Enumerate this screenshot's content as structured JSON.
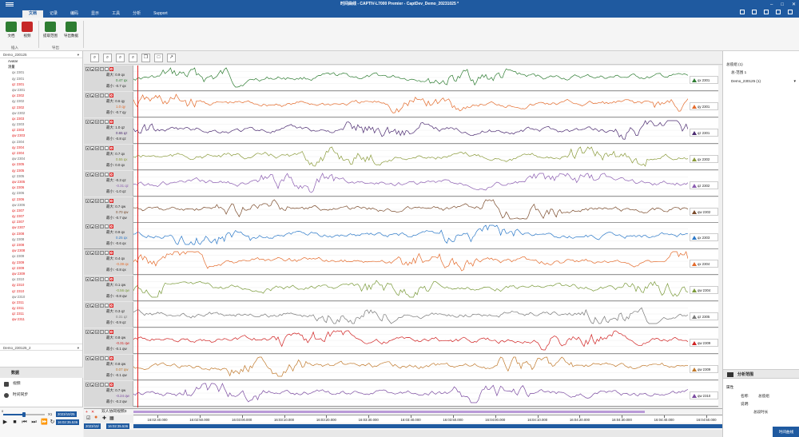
{
  "titlebar": {
    "title": "时间曲线 - CAPTIV-L7000 Premier - CaptDev_Demo_20231025 *"
  },
  "menu": {
    "tabs": [
      "文档",
      "记录",
      "编码",
      "显示",
      "工具",
      "分析",
      "Support"
    ],
    "active_index": 0
  },
  "ribbon": {
    "buttons": [
      {
        "label": "文档",
        "icon": "document-icon",
        "color": "#2e7d32"
      },
      {
        "label": "视频",
        "icon": "video-icon",
        "color": "#c62828"
      },
      {
        "label": "提取范围",
        "icon": "extract-range-icon",
        "color": "#2e7d32"
      },
      {
        "label": "导出数据",
        "icon": "export-data-icon",
        "color": "#2e7d32"
      }
    ],
    "groups": [
      "插入",
      "导出"
    ]
  },
  "left_panel": {
    "project_title": "Demo_230125",
    "tree": [
      {
        "label": "Avatar",
        "level": 1,
        "style": "normal"
      },
      {
        "label": "测量",
        "level": 1,
        "style": "normal"
      },
      {
        "label": "qx 2301",
        "level": 2,
        "style": "gray"
      },
      {
        "label": "qy 2301",
        "level": 2,
        "style": "gray"
      },
      {
        "label": "qz 2301",
        "level": 2,
        "style": "red"
      },
      {
        "label": "qw 2301",
        "level": 2,
        "style": "gray"
      },
      {
        "label": "qx 2302",
        "level": 2,
        "style": "red"
      },
      {
        "label": "qy 2302",
        "level": 2,
        "style": "gray"
      },
      {
        "label": "qz 2302",
        "level": 2,
        "style": "red"
      },
      {
        "label": "qw 2302",
        "level": 2,
        "style": "gray"
      },
      {
        "label": "qx 2303",
        "level": 2,
        "style": "red"
      },
      {
        "label": "qy 2303",
        "level": 2,
        "style": "gray"
      },
      {
        "label": "qz 2303",
        "level": 2,
        "style": "red"
      },
      {
        "label": "qw 2303",
        "level": 2,
        "style": "red"
      },
      {
        "label": "qx 2304",
        "level": 2,
        "style": "gray"
      },
      {
        "label": "qy 2304",
        "level": 2,
        "style": "red"
      },
      {
        "label": "qz 2304",
        "level": 2,
        "style": "red"
      },
      {
        "label": "qw 2304",
        "level": 2,
        "style": "gray"
      },
      {
        "label": "qx 2305",
        "level": 2,
        "style": "red"
      },
      {
        "label": "qy 2305",
        "level": 2,
        "style": "red"
      },
      {
        "label": "qz 2305",
        "level": 2,
        "style": "gray"
      },
      {
        "label": "qw 2305",
        "level": 2,
        "style": "red"
      },
      {
        "label": "qx 2306",
        "level": 2,
        "style": "red"
      },
      {
        "label": "qy 2306",
        "level": 2,
        "style": "gray"
      },
      {
        "label": "qz 2306",
        "level": 2,
        "style": "red"
      },
      {
        "label": "qw 2306",
        "level": 2,
        "style": "gray"
      },
      {
        "label": "qx 2307",
        "level": 2,
        "style": "red"
      },
      {
        "label": "qy 2307",
        "level": 2,
        "style": "red"
      },
      {
        "label": "qz 2307",
        "level": 2,
        "style": "red"
      },
      {
        "label": "qw 2307",
        "level": 2,
        "style": "red"
      },
      {
        "label": "qx 2308",
        "level": 2,
        "style": "red"
      },
      {
        "label": "qy 2308",
        "level": 2,
        "style": "gray"
      },
      {
        "label": "qz 2308",
        "level": 2,
        "style": "red"
      },
      {
        "label": "qw 2308",
        "level": 2,
        "style": "red"
      },
      {
        "label": "qx 2309",
        "level": 2,
        "style": "gray"
      },
      {
        "label": "qy 2309",
        "level": 2,
        "style": "red"
      },
      {
        "label": "qz 2309",
        "level": 2,
        "style": "red"
      },
      {
        "label": "qw 2309",
        "level": 2,
        "style": "red"
      },
      {
        "label": "qx 2310",
        "level": 2,
        "style": "gray"
      },
      {
        "label": "qy 2310",
        "level": 2,
        "style": "red"
      },
      {
        "label": "qz 2310",
        "level": 2,
        "style": "red"
      },
      {
        "label": "qw 2310",
        "level": 2,
        "style": "gray"
      },
      {
        "label": "qx 2311",
        "level": 2,
        "style": "red"
      },
      {
        "label": "qy 2311",
        "level": 2,
        "style": "red"
      },
      {
        "label": "qz 2311",
        "level": 2,
        "style": "red"
      },
      {
        "label": "qw 2311",
        "level": 2,
        "style": "red"
      }
    ],
    "second_project": "Demo_230125_2",
    "nav": {
      "section": "数据",
      "items": [
        "视频",
        "时间同步"
      ]
    }
  },
  "player": {
    "speed_min": "0",
    "speed_value": "X1",
    "date_top": "2023/10/25",
    "time_top": "16:02:35.536",
    "date_bottom": "2023/10/",
    "time_bottom": "16:02:35.536"
  },
  "tracks": [
    {
      "max": "最大: 0.9 qx",
      "cur": "0.47 qx",
      "min": "最小: -0.7 qx",
      "legend": "qx 2301",
      "color": "#2e7d32"
    },
    {
      "max": "最大: 0.6 qy",
      "cur": "1.0 qy",
      "min": "最小: -0.7 qy",
      "legend": "qy 2301",
      "color": "#e46a2a"
    },
    {
      "max": "最大: 1.0 qz",
      "cur": "0.65 qz",
      "min": "最小: -0.8 qz",
      "legend": "qz 2301",
      "color": "#4b2a70"
    },
    {
      "max": "最大: 0.7 qx",
      "cur": "0.55 qx",
      "min": "最小: 0.0 qx",
      "legend": "qx 2302",
      "color": "#8a9a3a"
    },
    {
      "max": "最大: -0.3 qz",
      "cur": "-0.31 qz",
      "min": "最小: -1.0 qz",
      "legend": "qz 2302",
      "color": "#8a5bb0"
    },
    {
      "max": "最大: 0.7 qw",
      "cur": "0.70 qw",
      "min": "最小: -0.7 qw",
      "legend": "qw 2302",
      "color": "#7a4a2a"
    },
    {
      "max": "最大: 0.9 qx",
      "cur": "0.25 qx",
      "min": "最小: -0.6 qx",
      "legend": "qx 2303",
      "color": "#2a78c8"
    },
    {
      "max": "最大: 0.4 qx",
      "cur": "-0.39 qx",
      "min": "最小: -0.8 qx",
      "legend": "qx 2304",
      "color": "#e46a2a"
    },
    {
      "max": "最大: 0.1 qw",
      "cur": "-0.56 qw",
      "min": "最小: -0.8 qw",
      "legend": "qw 2304",
      "color": "#7a9a3a"
    },
    {
      "max": "最大: 0.3 qz",
      "cur": "0.31 qz",
      "min": "最小: -0.9 qz",
      "legend": "qz 2305",
      "color": "#777777"
    },
    {
      "max": "最大: 0.8 qw",
      "cur": "-0.31 qw",
      "min": "最小: -0.1 qw",
      "legend": "qw 2309",
      "color": "#d02020"
    },
    {
      "max": "最大: 0.8 qw",
      "cur": "0.07 qw",
      "min": "最小: -0.1 qw",
      "legend": "qw 2309",
      "color": "#c0782a"
    },
    {
      "max": "最大: 0.7 qw",
      "cur": "-0.24 qw",
      "min": "最小: -0.2 qw",
      "legend": "qw 2310",
      "color": "#7a4aa0"
    }
  ],
  "activity": {
    "label": "双人协同视频3"
  },
  "timeaxis": {
    "ticks": [
      "16:02:40.000",
      "16:02:50.000",
      "16:03:00.000",
      "16:03:10.000",
      "16:03:20.000",
      "16:03:30.000",
      "16:03:40.000",
      "16:03:50.000",
      "16:04:00.000",
      "16:04:10.000",
      "16:04:20.000",
      "16:04:30.000",
      "16:04:40.000",
      "16:04:50.000"
    ]
  },
  "cursor": {
    "date": "2023/10/",
    "time": "16:02:35.536"
  },
  "right_panel": {
    "header": "总揽组 (1)",
    "group_item": "总-范围 1",
    "project": "Demo_230125 (1)",
    "section": "分析范围",
    "attr_title": "属性",
    "name_label": "名称:",
    "name_value": "总揽组",
    "desc_label": "说明:",
    "duration_label": "总段时长",
    "footer": "时间曲线"
  }
}
